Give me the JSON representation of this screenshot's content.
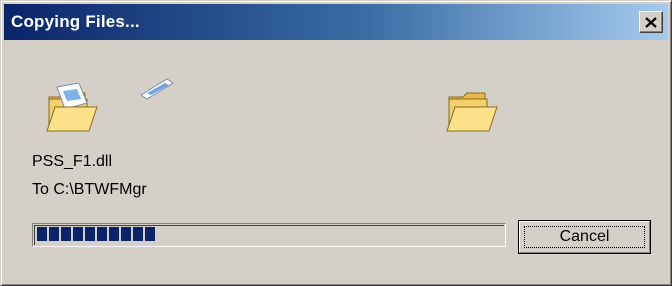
{
  "window": {
    "title": "Copying Files...",
    "close_glyph": "✕"
  },
  "icons": {
    "source_folder": "open-folder-icon",
    "flying_document": "document-flying-icon",
    "destination_folder": "open-folder-icon"
  },
  "file": {
    "name": "PSS_F1.dll",
    "destination": "To C:\\BTWFMgr"
  },
  "progress": {
    "blocks_filled": 10,
    "fraction": 0.29,
    "bar_color": "#0a246a"
  },
  "buttons": {
    "cancel_label": "Cancel"
  },
  "colors": {
    "title_start": "#0a246a",
    "title_end": "#a6caf0",
    "face": "#d4d0c8"
  }
}
